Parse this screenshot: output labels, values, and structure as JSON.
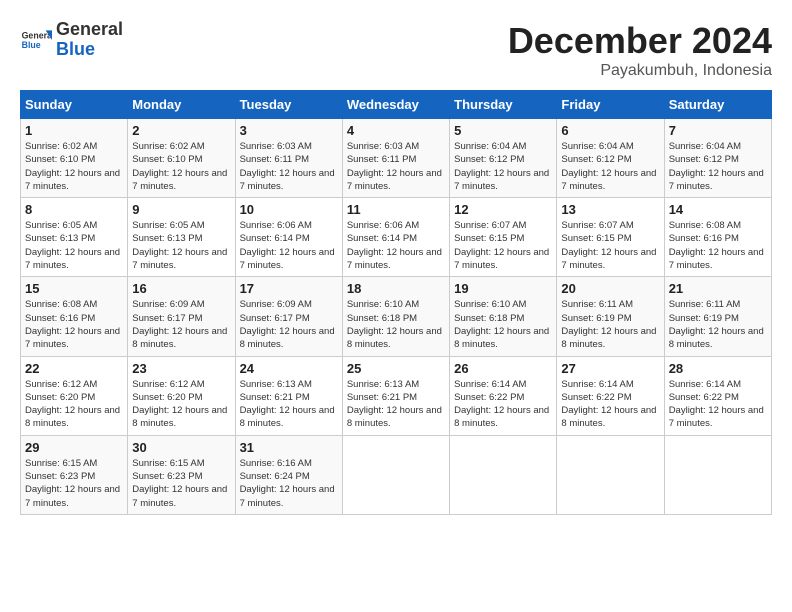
{
  "header": {
    "logo_general": "General",
    "logo_blue": "Blue",
    "month": "December 2024",
    "location": "Payakumbuh, Indonesia"
  },
  "days_of_week": [
    "Sunday",
    "Monday",
    "Tuesday",
    "Wednesday",
    "Thursday",
    "Friday",
    "Saturday"
  ],
  "weeks": [
    [
      {
        "day": "1",
        "sunrise": "6:02 AM",
        "sunset": "6:10 PM",
        "daylight": "12 hours and 7 minutes."
      },
      {
        "day": "2",
        "sunrise": "6:02 AM",
        "sunset": "6:10 PM",
        "daylight": "12 hours and 7 minutes."
      },
      {
        "day": "3",
        "sunrise": "6:03 AM",
        "sunset": "6:11 PM",
        "daylight": "12 hours and 7 minutes."
      },
      {
        "day": "4",
        "sunrise": "6:03 AM",
        "sunset": "6:11 PM",
        "daylight": "12 hours and 7 minutes."
      },
      {
        "day": "5",
        "sunrise": "6:04 AM",
        "sunset": "6:12 PM",
        "daylight": "12 hours and 7 minutes."
      },
      {
        "day": "6",
        "sunrise": "6:04 AM",
        "sunset": "6:12 PM",
        "daylight": "12 hours and 7 minutes."
      },
      {
        "day": "7",
        "sunrise": "6:04 AM",
        "sunset": "6:12 PM",
        "daylight": "12 hours and 7 minutes."
      }
    ],
    [
      {
        "day": "8",
        "sunrise": "6:05 AM",
        "sunset": "6:13 PM",
        "daylight": "12 hours and 7 minutes."
      },
      {
        "day": "9",
        "sunrise": "6:05 AM",
        "sunset": "6:13 PM",
        "daylight": "12 hours and 7 minutes."
      },
      {
        "day": "10",
        "sunrise": "6:06 AM",
        "sunset": "6:14 PM",
        "daylight": "12 hours and 7 minutes."
      },
      {
        "day": "11",
        "sunrise": "6:06 AM",
        "sunset": "6:14 PM",
        "daylight": "12 hours and 7 minutes."
      },
      {
        "day": "12",
        "sunrise": "6:07 AM",
        "sunset": "6:15 PM",
        "daylight": "12 hours and 7 minutes."
      },
      {
        "day": "13",
        "sunrise": "6:07 AM",
        "sunset": "6:15 PM",
        "daylight": "12 hours and 7 minutes."
      },
      {
        "day": "14",
        "sunrise": "6:08 AM",
        "sunset": "6:16 PM",
        "daylight": "12 hours and 7 minutes."
      }
    ],
    [
      {
        "day": "15",
        "sunrise": "6:08 AM",
        "sunset": "6:16 PM",
        "daylight": "12 hours and 7 minutes."
      },
      {
        "day": "16",
        "sunrise": "6:09 AM",
        "sunset": "6:17 PM",
        "daylight": "12 hours and 8 minutes."
      },
      {
        "day": "17",
        "sunrise": "6:09 AM",
        "sunset": "6:17 PM",
        "daylight": "12 hours and 8 minutes."
      },
      {
        "day": "18",
        "sunrise": "6:10 AM",
        "sunset": "6:18 PM",
        "daylight": "12 hours and 8 minutes."
      },
      {
        "day": "19",
        "sunrise": "6:10 AM",
        "sunset": "6:18 PM",
        "daylight": "12 hours and 8 minutes."
      },
      {
        "day": "20",
        "sunrise": "6:11 AM",
        "sunset": "6:19 PM",
        "daylight": "12 hours and 8 minutes."
      },
      {
        "day": "21",
        "sunrise": "6:11 AM",
        "sunset": "6:19 PM",
        "daylight": "12 hours and 8 minutes."
      }
    ],
    [
      {
        "day": "22",
        "sunrise": "6:12 AM",
        "sunset": "6:20 PM",
        "daylight": "12 hours and 8 minutes."
      },
      {
        "day": "23",
        "sunrise": "6:12 AM",
        "sunset": "6:20 PM",
        "daylight": "12 hours and 8 minutes."
      },
      {
        "day": "24",
        "sunrise": "6:13 AM",
        "sunset": "6:21 PM",
        "daylight": "12 hours and 8 minutes."
      },
      {
        "day": "25",
        "sunrise": "6:13 AM",
        "sunset": "6:21 PM",
        "daylight": "12 hours and 8 minutes."
      },
      {
        "day": "26",
        "sunrise": "6:14 AM",
        "sunset": "6:22 PM",
        "daylight": "12 hours and 8 minutes."
      },
      {
        "day": "27",
        "sunrise": "6:14 AM",
        "sunset": "6:22 PM",
        "daylight": "12 hours and 8 minutes."
      },
      {
        "day": "28",
        "sunrise": "6:14 AM",
        "sunset": "6:22 PM",
        "daylight": "12 hours and 7 minutes."
      }
    ],
    [
      {
        "day": "29",
        "sunrise": "6:15 AM",
        "sunset": "6:23 PM",
        "daylight": "12 hours and 7 minutes."
      },
      {
        "day": "30",
        "sunrise": "6:15 AM",
        "sunset": "6:23 PM",
        "daylight": "12 hours and 7 minutes."
      },
      {
        "day": "31",
        "sunrise": "6:16 AM",
        "sunset": "6:24 PM",
        "daylight": "12 hours and 7 minutes."
      },
      null,
      null,
      null,
      null
    ]
  ]
}
